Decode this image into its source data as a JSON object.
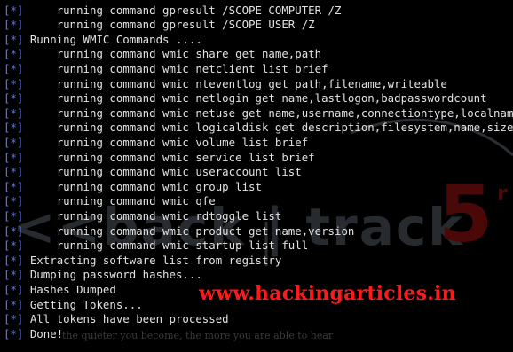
{
  "terminal": {
    "lines": [
      {
        "tag": "[*]",
        "text": "     running command gpresult /SCOPE COMPUTER /Z"
      },
      {
        "tag": "[*]",
        "text": "     running command gpresult /SCOPE USER /Z"
      },
      {
        "tag": "[*]",
        "text": " Running WMIC Commands ...."
      },
      {
        "tag": "[*]",
        "text": "     running command wmic share get name,path"
      },
      {
        "tag": "[*]",
        "text": "     running command wmic netclient list brief"
      },
      {
        "tag": "[*]",
        "text": "     running command wmic nteventlog get path,filename,writeable"
      },
      {
        "tag": "[*]",
        "text": "     running command wmic netlogin get name,lastlogon,badpasswordcount"
      },
      {
        "tag": "[*]",
        "text": "     running command wmic netuse get name,username,connectiontype,localname"
      },
      {
        "tag": "[*]",
        "text": "     running command wmic logicaldisk get description,filesystem,name,size"
      },
      {
        "tag": "[*]",
        "text": "     running command wmic volume list brief"
      },
      {
        "tag": "[*]",
        "text": "     running command wmic service list brief"
      },
      {
        "tag": "[*]",
        "text": "     running command wmic useraccount list"
      },
      {
        "tag": "[*]",
        "text": "     running command wmic group list"
      },
      {
        "tag": "[*]",
        "text": "     running command wmic qfe"
      },
      {
        "tag": "[*]",
        "text": "     running command wmic rdtoggle list"
      },
      {
        "tag": "[*]",
        "text": "     running command wmic product get name,version"
      },
      {
        "tag": "[*]",
        "text": "     running command wmic startup list full"
      },
      {
        "tag": "[*]",
        "text": " Extracting software list from registry"
      },
      {
        "tag": "[*]",
        "text": " Dumping password hashes..."
      },
      {
        "tag": "[*]",
        "text": " Hashes Dumped"
      },
      {
        "tag": "[*]",
        "text": " Getting Tokens..."
      },
      {
        "tag": "[*]",
        "text": " All tokens have been processed"
      },
      {
        "tag": "[*]",
        "text": " Done!"
      }
    ]
  },
  "watermark": {
    "logo_text": "<<back | track",
    "logo_number": "5",
    "logo_suffix": "r",
    "quote": "the quieter you become, the more you are able to hear"
  },
  "overlay": {
    "site": "www.hackingarticles.in"
  },
  "colors": {
    "background": "#000000",
    "text": "#e2e2e2",
    "tag": "#5577ff",
    "site": "#ff1a1a"
  }
}
